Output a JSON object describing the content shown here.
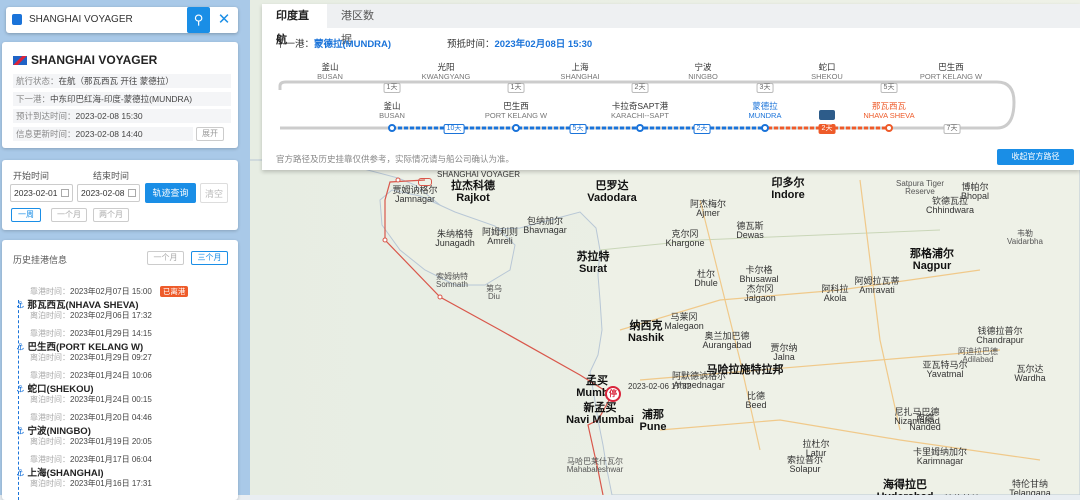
{
  "search": {
    "value": "SHANGHAI VOYAGER",
    "search_icon": "search-icon",
    "close_icon": "close-icon"
  },
  "ship": {
    "name": "SHANGHAI VOYAGER",
    "status_label": "航行状态：",
    "status_value": "在航（那瓦西瓦 开往 蒙德拉）",
    "next_port_label": "下一港：",
    "next_port_value": "中东印巴红海-印度-蒙德拉(MUNDRA)",
    "eta_label": "预计到达时间：",
    "eta_value": "2023-02-08 15:30",
    "updated_label": "信息更新时间：",
    "updated_value": "2023-02-08 14:40",
    "expand_label": "展开"
  },
  "query": {
    "start_label": "开始时间",
    "end_label": "结束时间",
    "start_value": "2023-02-01",
    "end_value": "2023-02-08",
    "track_button": "轨迹查询",
    "clear_button": "清空",
    "range_week": "一周",
    "range_month": "一个月",
    "range_two_month": "两个月"
  },
  "history": {
    "title": "历史挂港信息",
    "range_month": "一个月",
    "range_three_month": "三个月",
    "arrive_label": "靠港时间：",
    "depart_label": "离泊时间：",
    "departed_badge": "已离港",
    "items": [
      {
        "arrive": "2023年02月07日 15:00",
        "port": "那瓦西瓦(NHAVA SHEVA)",
        "depart": "2023年02月06日 17:32"
      },
      {
        "arrive": "2023年01月29日 14:15",
        "port": "巴生西(PORT KELANG W)",
        "depart": "2023年01月29日 09:27"
      },
      {
        "arrive": "2023年01月24日 10:06",
        "port": "蛇口(SHEKOU)",
        "depart": "2023年01月24日 00:15"
      },
      {
        "arrive": "2023年01月20日 04:46",
        "port": "宁波(NINGBO)",
        "depart": "2023年01月19日 20:05"
      },
      {
        "arrive": "2023年01月17日 06:04",
        "port": "上海(SHANGHAI)",
        "depart": "2023年01月16日 17:31"
      }
    ]
  },
  "route": {
    "tab_direct": "印度直航",
    "tab_port": "港区数据",
    "next_port_label": "下一港：",
    "next_port_value": "蒙德拉(MUNDRA)",
    "eta_label": "预抵时间：",
    "eta_value": "2023年02月08日 15:30",
    "footnote": "官方路径及历史挂靠仅供参考，实际情况请与船公司确认为准。",
    "collect_button": "收起官方路径",
    "top_ports": [
      {
        "cn": "釜山",
        "en": "BUSAN"
      },
      {
        "cn": "光阳",
        "en": "KWANGYANG"
      },
      {
        "cn": "上海",
        "en": "SHANGHAI"
      },
      {
        "cn": "宁波",
        "en": "NINGBO"
      },
      {
        "cn": "蛇口",
        "en": "SHEKOU"
      },
      {
        "cn": "巴生西",
        "en": "PORT KELANG W"
      }
    ],
    "top_days": [
      "1天",
      "1天",
      "2天",
      "3天",
      "5天"
    ],
    "bottom_ports": [
      {
        "cn": "釜山",
        "en": "BUSAN"
      },
      {
        "cn": "巴生西",
        "en": "PORT KELANG W"
      },
      {
        "cn": "卡拉奇SAPT港",
        "en": "KARACHI--SAPT"
      },
      {
        "cn": "蒙德拉",
        "en": "MUNDRA"
      },
      {
        "cn": "那瓦西瓦",
        "en": "NHAVA SHEVA"
      }
    ],
    "bottom_days": [
      "10天",
      "5天",
      "2天",
      "2天",
      "7天"
    ]
  },
  "map": {
    "ship_marker_time": "2023-02-06 17:32",
    "ship_marker_badge": "停",
    "ship_label": "SHANGHAI VOYAGER",
    "labels": [
      {
        "text": "贾姆讷格尔\nJamnagar",
        "cls": ""
      },
      {
        "text": "拉杰科德\nRajkot",
        "cls": "big"
      },
      {
        "text": "巴罗达\nVadodara",
        "cls": "big"
      },
      {
        "text": "阿杰梅尔\nAjmer",
        "cls": ""
      },
      {
        "text": "阿姆利则\nAmreli",
        "cls": ""
      },
      {
        "text": "朱纳格特\nJunagadh",
        "cls": ""
      },
      {
        "text": "包纳加尔\nBhavnagar",
        "cls": ""
      },
      {
        "text": "苏拉特\nSurat",
        "cls": "big"
      },
      {
        "text": "索姆纳特\nSomnath",
        "cls": "small"
      },
      {
        "text": "第乌\nDiu",
        "cls": "small"
      },
      {
        "text": "纳西克\nNashik",
        "cls": "big"
      },
      {
        "text": "孟买\nMumbai",
        "cls": "big"
      },
      {
        "text": "新孟买\nNavi Mumbai",
        "cls": "big"
      },
      {
        "text": "浦那\nPune",
        "cls": "big"
      },
      {
        "text": "印多尔\nIndore",
        "cls": "big"
      },
      {
        "text": "博帕尔\nBhopal",
        "cls": ""
      },
      {
        "text": "那格浦尔\nNagpur",
        "cls": "big"
      },
      {
        "text": "奥兰加巴德\nAurangabad",
        "cls": ""
      },
      {
        "text": "阿默德讷格尔\nAhmednagar",
        "cls": ""
      },
      {
        "text": "索拉普尔\nSolapur",
        "cls": ""
      },
      {
        "text": "海得拉巴\nHyderabad",
        "cls": "big"
      },
      {
        "text": "特伦甘纳\nTelangana",
        "cls": ""
      },
      {
        "text": "马哈拉施特拉邦",
        "cls": "big"
      },
      {
        "text": "Satpura Tiger\nReserve",
        "cls": "small"
      },
      {
        "text": "钦德瓦拉\nChhindwara",
        "cls": ""
      },
      {
        "text": "阿姆拉瓦蒂\nAmravati",
        "cls": ""
      },
      {
        "text": "阿科拉\nAkola",
        "cls": ""
      },
      {
        "text": "杰尔冈\nJalgaon",
        "cls": ""
      },
      {
        "text": "杜尔\nDhule",
        "cls": ""
      },
      {
        "text": "马莱冈\nMalegaon",
        "cls": ""
      },
      {
        "text": "贾尔纳\nJalna",
        "cls": ""
      },
      {
        "text": "比德\nBeed",
        "cls": ""
      },
      {
        "text": "拉杜尔\nLatur",
        "cls": ""
      },
      {
        "text": "南德\nNanded",
        "cls": ""
      },
      {
        "text": "钱德拉普尔\nChandrapur",
        "cls": ""
      },
      {
        "text": "瓦尔达\nWardha",
        "cls": ""
      },
      {
        "text": "亚瓦特马尔\nYavatmal",
        "cls": ""
      },
      {
        "text": "马哈巴莱什瓦尔\nMahabaleshwar",
        "cls": "small"
      },
      {
        "text": "克尔冈\nKhargone",
        "cls": ""
      },
      {
        "text": "卡尔格\nBhusawal",
        "cls": ""
      },
      {
        "text": "阿迪拉巴德\nAdilabad",
        "cls": "small"
      },
      {
        "text": "卡里姆纳加尔\nKarimnagar",
        "cls": ""
      },
      {
        "text": "尼扎马巴德\nNizamabad",
        "cls": ""
      },
      {
        "text": "特伦甘纳\nTelangana",
        "cls": ""
      },
      {
        "text": "韦勒\nVaidarbha",
        "cls": "small"
      },
      {
        "text": "德瓦斯\nDewas",
        "cls": ""
      }
    ]
  },
  "colors": {
    "accent": "#1a8ee6",
    "route_blue": "#1a73d9",
    "route_orange": "#ee5b2a"
  }
}
